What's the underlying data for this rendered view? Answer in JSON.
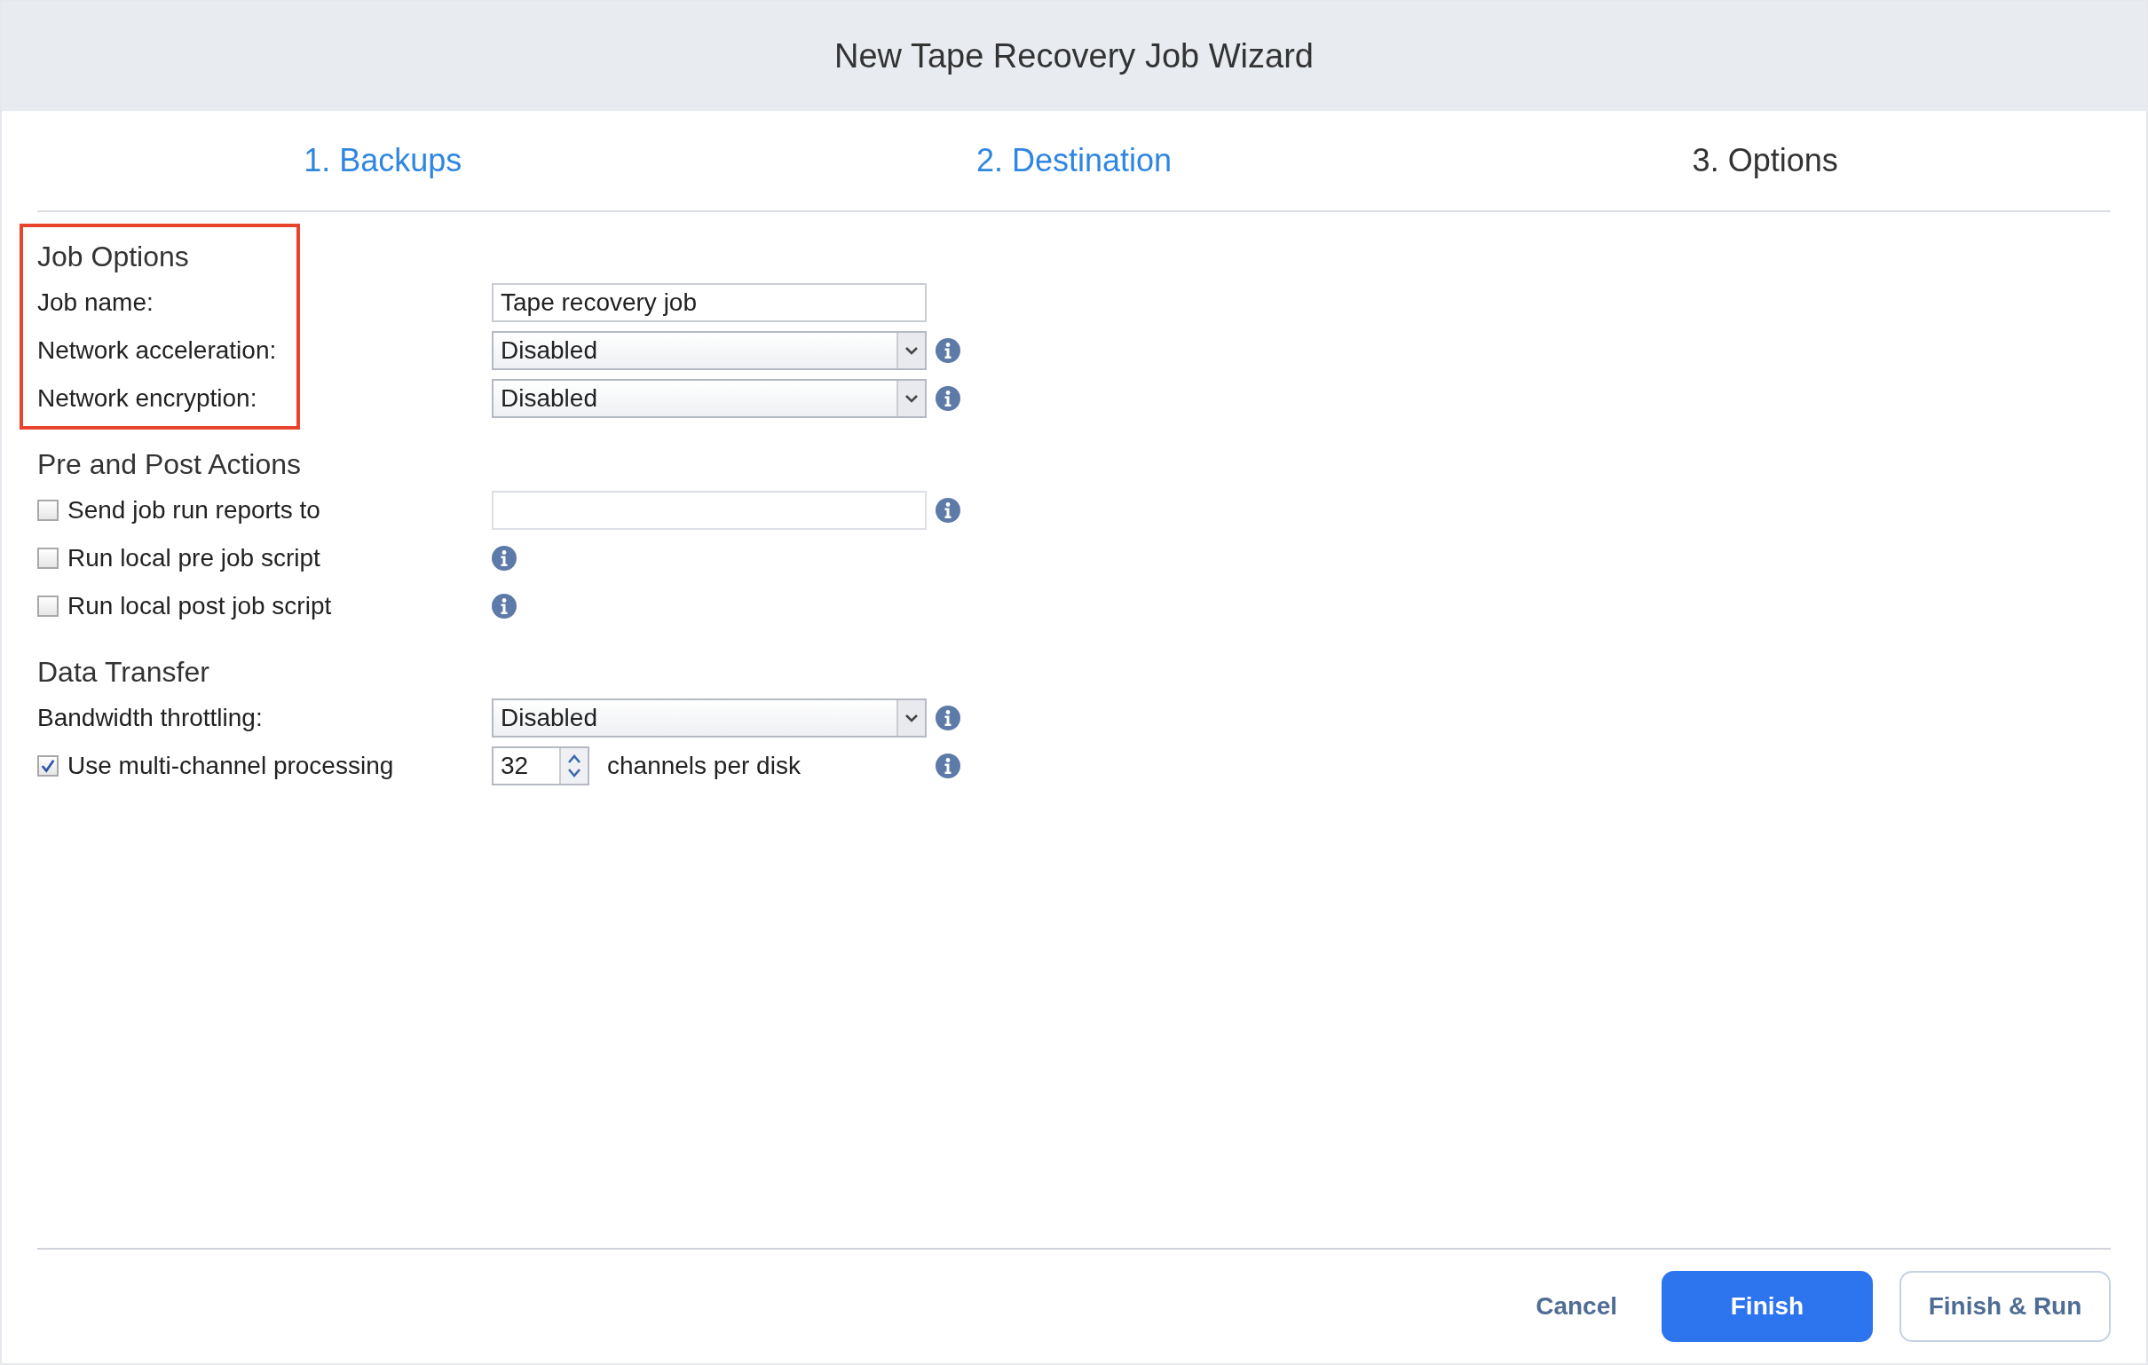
{
  "window": {
    "title": "New Tape Recovery Job Wizard"
  },
  "steps": [
    {
      "label": "1. Backups",
      "selected": false
    },
    {
      "label": "2. Destination",
      "selected": false
    },
    {
      "label": "3. Options",
      "selected": true
    }
  ],
  "sections": [
    {
      "heading": "Job Options",
      "highlighted": true,
      "rows": [
        {
          "kind": "text",
          "label": "Job name:",
          "value": "Tape recovery job",
          "info": false
        },
        {
          "kind": "select",
          "label": "Network acceleration:",
          "value": "Disabled",
          "info": true
        },
        {
          "kind": "select",
          "label": "Network encryption:",
          "value": "Disabled",
          "info": true
        }
      ]
    },
    {
      "heading": "Pre and Post Actions",
      "highlighted": false,
      "rows": [
        {
          "kind": "checkbox_text",
          "label": "Send job run reports to",
          "checked": false,
          "value": "",
          "info": true
        },
        {
          "kind": "checkbox",
          "label": "Run local pre job script",
          "checked": false,
          "info": true
        },
        {
          "kind": "checkbox",
          "label": "Run local post job script",
          "checked": false,
          "info": true
        }
      ]
    },
    {
      "heading": "Data Transfer",
      "highlighted": false,
      "rows": [
        {
          "kind": "select",
          "label": "Bandwidth throttling:",
          "value": "Disabled",
          "info": true
        },
        {
          "kind": "checkbox_number",
          "label": "Use multi-channel processing",
          "checked": true,
          "value": "32",
          "suffix": "channels per disk",
          "info": true
        }
      ]
    }
  ],
  "buttons": [
    {
      "label": "Cancel",
      "kind": "link"
    },
    {
      "label": "Finish",
      "kind": "primary"
    },
    {
      "label": "Finish & Run",
      "kind": "outline"
    }
  ]
}
